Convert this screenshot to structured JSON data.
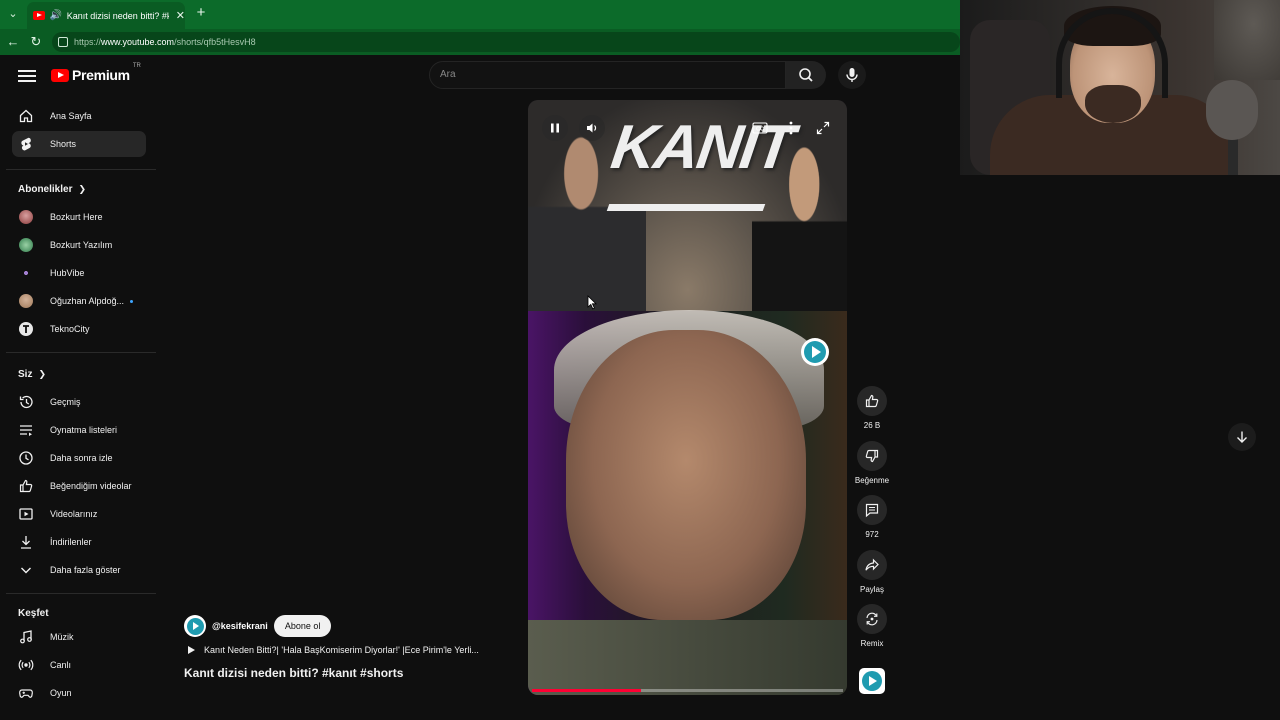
{
  "browser": {
    "tab_title": "Kanıt dizisi neden bitti? #kanı",
    "url_prefix": "https://",
    "url_host": "www.youtube.com",
    "url_path": "/shorts/qfb5tHesvH8"
  },
  "header": {
    "brand": "Premium",
    "country": "TR",
    "search_placeholder": "Ara"
  },
  "sidebar": {
    "main": [
      {
        "label": "Ana Sayfa",
        "icon": "home-icon"
      },
      {
        "label": "Shorts",
        "icon": "shorts-icon"
      }
    ],
    "subscriptions_title": "Abonelikler",
    "subscriptions": [
      {
        "label": "Bozkurt Here",
        "color": "#8a3b3b"
      },
      {
        "label": "Bozkurt Yazılım",
        "color": "#2f7a4a"
      },
      {
        "label": "HubVibe",
        "color": "#6b3fa0"
      },
      {
        "label": "Oğuzhan Alpdoğ...",
        "color": "#a07a5a"
      },
      {
        "label": "TeknoCity",
        "color": "#e8e8e8"
      }
    ],
    "you_title": "Siz",
    "you": [
      {
        "label": "Geçmiş",
        "icon": "history-icon"
      },
      {
        "label": "Oynatma listeleri",
        "icon": "playlists-icon"
      },
      {
        "label": "Daha sonra izle",
        "icon": "watch-later-icon"
      },
      {
        "label": "Beğendiğim videolar",
        "icon": "liked-videos-icon"
      },
      {
        "label": "Videolarınız",
        "icon": "your-videos-icon"
      },
      {
        "label": "İndirilenler",
        "icon": "downloads-icon"
      },
      {
        "label": "Daha fazla göster",
        "icon": "chevron-down-icon"
      }
    ],
    "explore_title": "Keşfet",
    "explore": [
      {
        "label": "Müzik",
        "icon": "music-icon"
      },
      {
        "label": "Canlı",
        "icon": "live-icon"
      },
      {
        "label": "Oyun",
        "icon": "gaming-icon"
      }
    ]
  },
  "short": {
    "overlay_text": "KANIT",
    "progress": 0.35,
    "channel_handle": "@kesifekrani",
    "subscribe_label": "Abone ol",
    "linked_video": "Kanıt Neden Bitti?| 'Hala BaşKomiserim Diyorlar!' |Ece Pirim'le Yerli...",
    "title": "Kanıt dizisi neden bitti? #kanıt #shorts"
  },
  "actions": {
    "like_count": "26 B",
    "dislike_label": "Beğenme",
    "comment_count": "972",
    "share_label": "Paylaş",
    "remix_label": "Remix"
  },
  "colors": {
    "browser_chrome": "#0a5c23",
    "youtube_red": "#ff0000",
    "background": "#0f0f0f"
  }
}
